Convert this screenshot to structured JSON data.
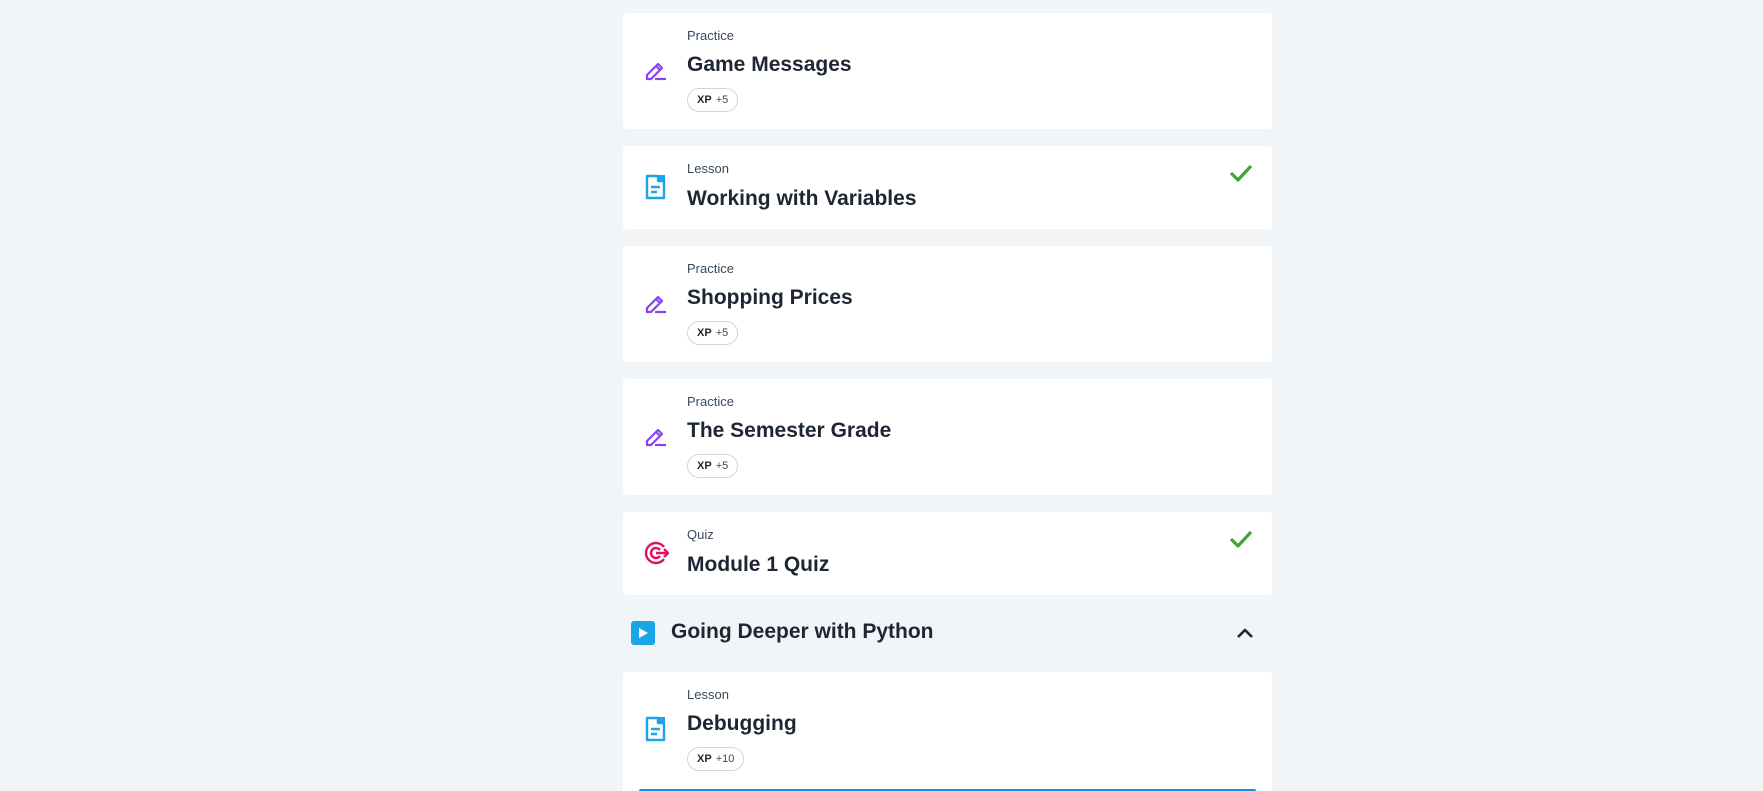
{
  "items": [
    {
      "type": "Practice",
      "title": "Game Messages",
      "xp_label": "XP",
      "xp_value": "+5",
      "completed": false,
      "icon": "pencil-icon"
    },
    {
      "type": "Lesson",
      "title": "Working with Variables",
      "completed": true,
      "icon": "document-icon"
    },
    {
      "type": "Practice",
      "title": "Shopping Prices",
      "xp_label": "XP",
      "xp_value": "+5",
      "completed": false,
      "icon": "pencil-icon"
    },
    {
      "type": "Practice",
      "title": "The Semester Grade",
      "xp_label": "XP",
      "xp_value": "+5",
      "completed": false,
      "icon": "pencil-icon"
    },
    {
      "type": "Quiz",
      "title": "Module 1 Quiz",
      "completed": true,
      "icon": "target-icon"
    }
  ],
  "section": {
    "title": "Going Deeper with Python",
    "expanded": true,
    "items": [
      {
        "type": "Lesson",
        "title": "Debugging",
        "xp_label": "XP",
        "xp_value": "+10",
        "icon": "document-icon"
      }
    ]
  },
  "colors": {
    "background": "#f2f5f8",
    "practice_icon": "#8a3ffc",
    "lesson_icon": "#1aa5e8",
    "quiz_icon": "#e0115f",
    "check": "#3fa63a",
    "accent_blue": "#1a8be6"
  }
}
